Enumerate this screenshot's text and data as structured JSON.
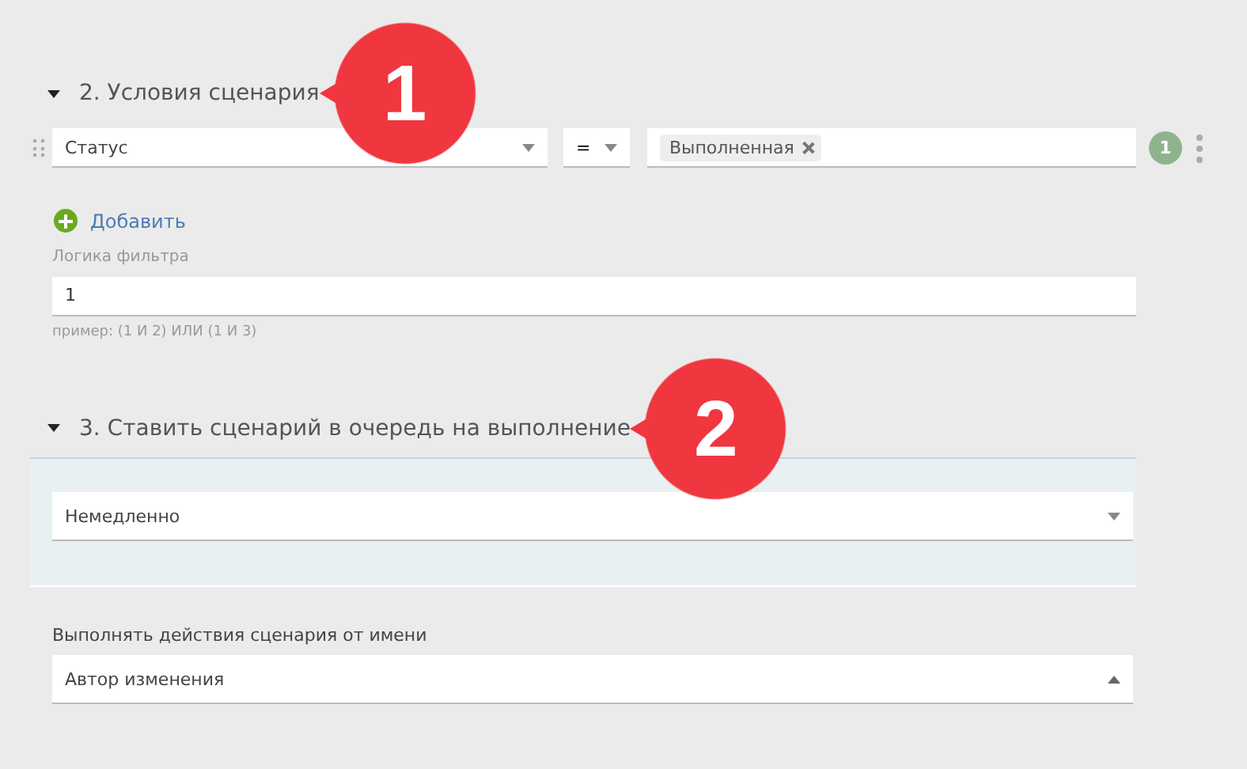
{
  "sections": [
    {
      "title": "2. Условия сценария",
      "expanded": true,
      "callout": "1",
      "kind": "conditions",
      "condition": {
        "field": "Статус",
        "operator": "=",
        "values": [
          "Выполненная"
        ],
        "number": "1"
      },
      "add_link": "Добавить",
      "logic_label": "Логика фильтра",
      "logic_value": "1",
      "logic_hint": "пример: (1 И 2) ИЛИ (1 И 3)"
    },
    {
      "title": "3. Ставить сценарий в очередь на выполнение",
      "expanded": true,
      "callout": "2",
      "kind": "queue",
      "timing": {
        "value": "Немедленно",
        "open": false
      },
      "run_as_label": "Выполнять действия сценария от имени",
      "run_as": {
        "value": "Автор изменения",
        "open": true
      }
    }
  ]
}
